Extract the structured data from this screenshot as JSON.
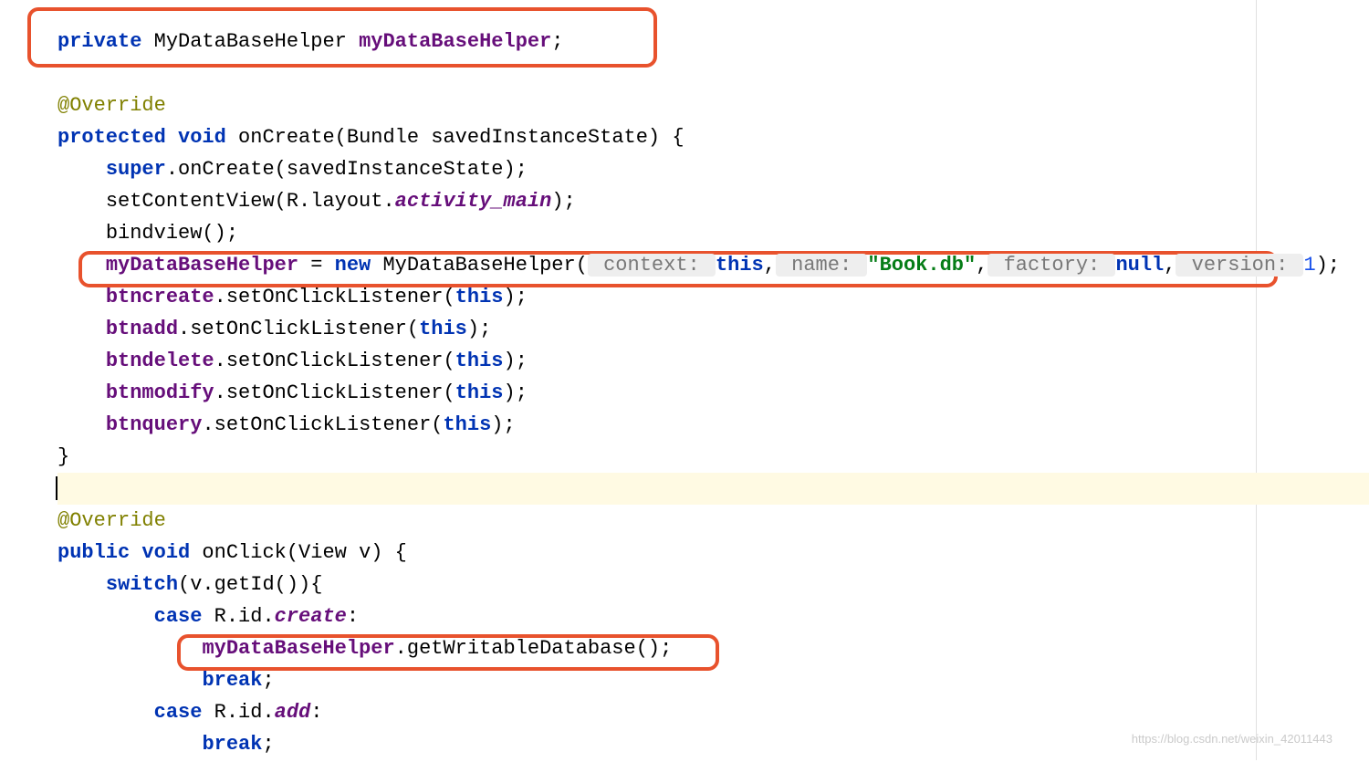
{
  "code": {
    "l1": {
      "kw": "private",
      "type": " MyDataBaseHelper ",
      "field": "myDataBaseHelper",
      "semi": ";"
    },
    "l2": "",
    "l3": {
      "anno": "@Override"
    },
    "l4": {
      "kw1": "protected",
      "sp": " ",
      "kw2": "void",
      "text": " onCreate(Bundle savedInstanceState) {"
    },
    "l5": {
      "kw": "super",
      "text": ".onCreate(savedInstanceState);"
    },
    "l6": {
      "pre": "setContentView(R.layout.",
      "it": "activity_main",
      "post": ");"
    },
    "l7": "bindview();",
    "l8": {
      "field": "myDataBaseHelper",
      "eq": " = ",
      "kw": "new",
      "ctor": " MyDataBaseHelper(",
      "h1": " context: ",
      "kw2": "this",
      "c1": ",",
      "h2": " name: ",
      "str": "\"Book.db\"",
      "c2": ",",
      "h3": " factory: ",
      "kw3": "null",
      "c3": ",",
      "h4": " version: ",
      "num": "1",
      "end": ");"
    },
    "l9": {
      "field": "btncreate",
      "text": ".setOnClickListener(",
      "kw": "this",
      "post": ");"
    },
    "l10": {
      "field": "btnadd",
      "text": ".setOnClickListener(",
      "kw": "this",
      "post": ");"
    },
    "l11": {
      "field": "btndelete",
      "text": ".setOnClickListener(",
      "kw": "this",
      "post": ");"
    },
    "l12": {
      "field": "btnmodify",
      "text": ".setOnClickListener(",
      "kw": "this",
      "post": ");"
    },
    "l13": {
      "field": "btnquery",
      "text": ".setOnClickListener(",
      "kw": "this",
      "post": ");"
    },
    "l14": "}",
    "l15": "",
    "l16": {
      "anno": "@Override"
    },
    "l17": {
      "kw1": "public",
      "sp": " ",
      "kw2": "void",
      "text": " onClick(View v) {"
    },
    "l18": {
      "kw": "switch",
      "text": "(v.getId()){"
    },
    "l19": {
      "kw": "case",
      "text": " R.id.",
      "it": "create",
      "colon": ":"
    },
    "l20": {
      "field": "myDataBaseHelper",
      "text": ".getWritableDatabase();"
    },
    "l21": {
      "kw": "break",
      "semi": ";"
    },
    "l22": {
      "kw": "case",
      "text": " R.id.",
      "it": "add",
      "colon": ":"
    },
    "l23": {
      "kw": "break",
      "semi": ";"
    }
  },
  "watermark": "https://blog.csdn.net/weixin_42011443"
}
